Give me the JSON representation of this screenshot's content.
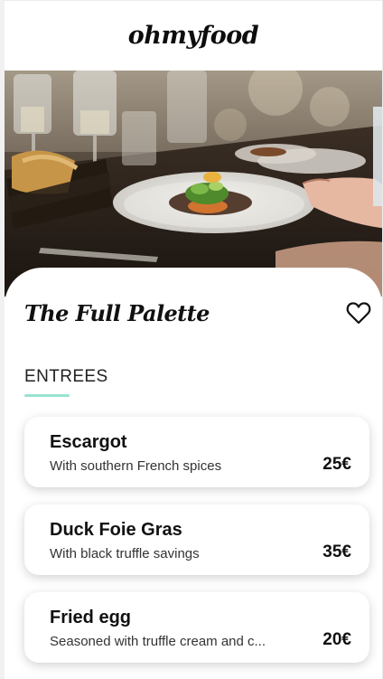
{
  "header": {
    "logo": "ohmyfood"
  },
  "hero": {
    "image_description": "restaurant table with plated dish, wine glasses and bread basket"
  },
  "restaurant": {
    "title": "The Full Palette",
    "favorite_icon": "heart-outline-icon"
  },
  "menu": {
    "section_label": "ENTREES",
    "accent_color": "#99e2d0",
    "items": [
      {
        "name": "Escargot",
        "description": "With southern French spices",
        "price": "25€"
      },
      {
        "name": "Duck Foie Gras",
        "description": "With black truffle savings",
        "price": "35€"
      },
      {
        "name": "Fried egg",
        "description": "Seasoned with truffle cream and c...",
        "price": "20€"
      }
    ]
  }
}
